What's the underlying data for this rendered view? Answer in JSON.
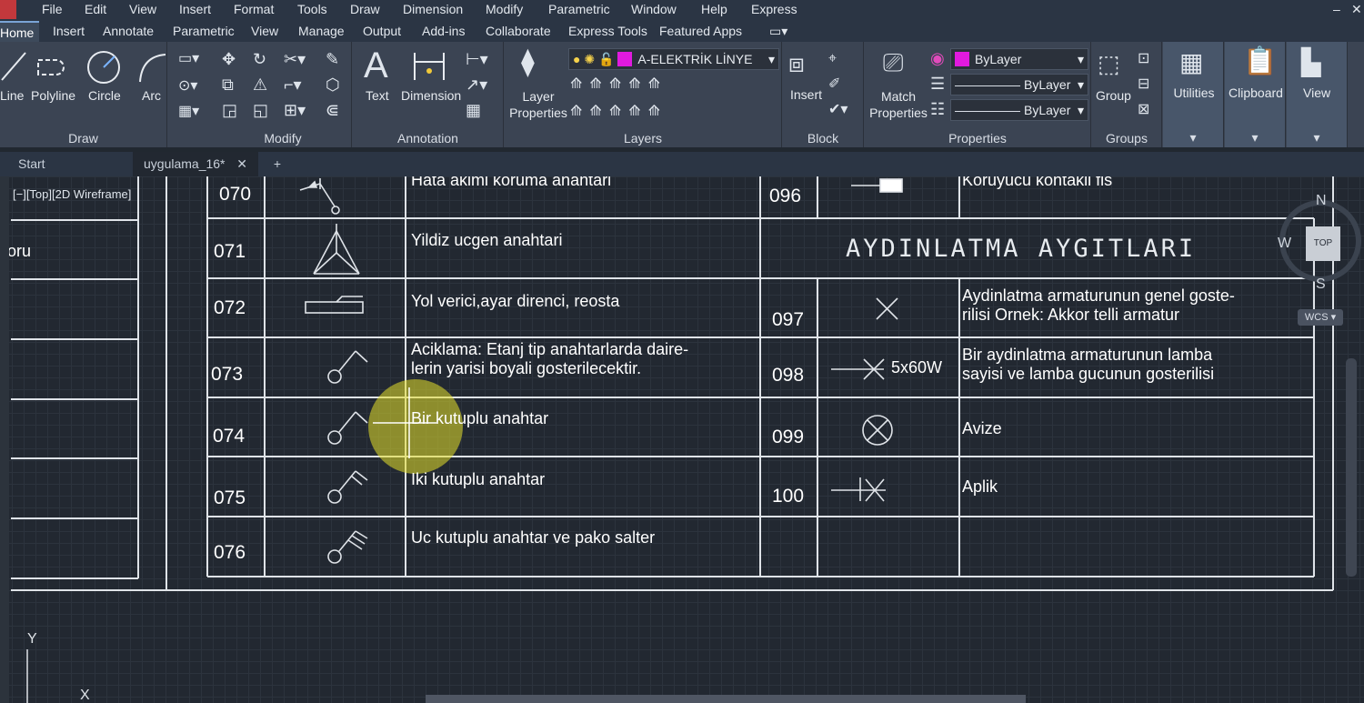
{
  "menu": [
    "File",
    "Edit",
    "View",
    "Insert",
    "Format",
    "Tools",
    "Draw",
    "Dimension",
    "Modify",
    "Parametric",
    "Window",
    "Help",
    "Express"
  ],
  "ribbon_tabs": [
    "Home",
    "Insert",
    "Annotate",
    "Parametric",
    "View",
    "Manage",
    "Output",
    "Add-ins",
    "Collaborate",
    "Express Tools",
    "Featured Apps"
  ],
  "draw": {
    "line": "Line",
    "polyline": "Polyline",
    "circle": "Circle",
    "arc": "Arc",
    "label": "Draw"
  },
  "modify": {
    "label": "Modify"
  },
  "annotation": {
    "text": "Text",
    "dimension": "Dimension",
    "label": "Annotation"
  },
  "layers": {
    "layer_properties": "Layer Properties",
    "current_layer": "A-ELEKTRİK LİNYE",
    "label": "Layers"
  },
  "block": {
    "insert": "Insert",
    "label": "Block"
  },
  "properties": {
    "match": "Match Properties",
    "color": "ByLayer",
    "linetype": "ByLayer",
    "lineweight": "ByLayer",
    "label": "Properties"
  },
  "groups": {
    "group": "Group",
    "label": "Groups"
  },
  "utilities": "Utilities",
  "clipboard": "Clipboard",
  "view_panel": "View",
  "doc_tabs": {
    "start": "Start",
    "file": "uygulama_16*"
  },
  "viewport_label": "[−][Top][2D Wireframe]",
  "left_fragment": "oru",
  "left_rows": [
    {
      "num": "070",
      "desc": "Hata akimi koruma anahtari"
    },
    {
      "num": "071",
      "desc": "Yildiz ucgen anahtari"
    },
    {
      "num": "072",
      "desc": "Yol verici,ayar direnci, reosta"
    },
    {
      "num": "073",
      "desc": "Aciklama: Etanj tip anahtarlarda daire-",
      "desc2": "lerin yarisi boyali gosterilecektir."
    },
    {
      "num": "074",
      "desc": "Bir kutuplu anahtar"
    },
    {
      "num": "075",
      "desc": "Iki kutuplu anahtar"
    },
    {
      "num": "076",
      "desc": "Uc kutuplu anahtar ve pako salter"
    }
  ],
  "right_rows": [
    {
      "num": "096",
      "desc": "Koruyucu kontakli fis"
    },
    {
      "num": "097",
      "desc": "Aydinlatma armaturunun genel goste-",
      "desc2": "rilisi Ornek: Akkor telli armatur"
    },
    {
      "num": "098",
      "desc": "Bir aydinlatma armaturunun lamba",
      "desc2": "sayisi ve lamba gucunun gosterilisi",
      "symbol_text": "5x60W"
    },
    {
      "num": "099",
      "desc": "Avize"
    },
    {
      "num": "100",
      "desc": "Aplik"
    }
  ],
  "section_title": "AYDINLATMA AYGITLARI",
  "navcube": {
    "n": "N",
    "w": "W",
    "s": "S",
    "top": "TOP",
    "wcs": "WCS"
  },
  "ucs": {
    "y": "Y",
    "x": "X"
  },
  "colors": {
    "highlight": "#e6e02a",
    "layer_swatch": "#e11adf"
  }
}
